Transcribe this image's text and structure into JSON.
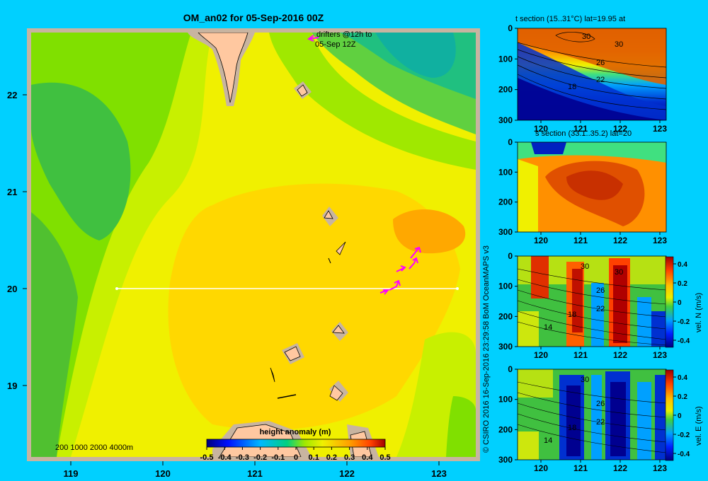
{
  "main_map": {
    "title": "OM_an02 for 05-Sep-2016 00Z",
    "drifters_label_1": "drifters @12h to",
    "drifters_label_2": "05-Sep 12Z",
    "depth_legend": "200  1000  2000  4000m",
    "colorbar_title": "height anomaly (m)",
    "colorbar_ticks": [
      "-0.5",
      "-0.4",
      "-0.3",
      "-0.2",
      "-0.1",
      "0",
      "0.1",
      "0.2",
      "0.3",
      "0.4",
      "0.5"
    ],
    "x_ticks": [
      "119",
      "120",
      "121",
      "122",
      "123"
    ],
    "y_ticks": [
      "22",
      "21",
      "20",
      "19"
    ],
    "section_line_lat": 20,
    "section_line_lon": [
      119.5,
      123.2
    ],
    "colors": {
      "land": "#ffc8a0",
      "shelf": "#c8b4a0",
      "border": "#c8b4a0",
      "drifter": "#ff00ff"
    }
  },
  "credit": "© CSIRO 2016   16-Sep-2016 23:29:58 BoM OceanMAPS v3",
  "chart_data": [
    {
      "type": "heatmap",
      "title": "OM_an02 for 05-Sep-2016 00Z",
      "x": [
        119,
        120,
        121,
        122,
        123
      ],
      "y": [
        19,
        20,
        21,
        22
      ],
      "legend_title": "height anomaly (m)",
      "clim": [
        -0.5,
        0.5
      ],
      "values_description_free": null
    },
    {
      "type": "heatmap",
      "title": "t section (15..31°C) lat=19.95 at",
      "x_ticks": [
        "120",
        "121",
        "122",
        "123"
      ],
      "y_ticks": [
        "0",
        "100",
        "200",
        "300"
      ],
      "contour_labels": [
        "30",
        "30",
        "26",
        "22",
        "18"
      ],
      "clim": [
        15,
        31
      ]
    },
    {
      "type": "heatmap",
      "title": "s section (33.1..35.2) lat=20",
      "x_ticks": [
        "120",
        "121",
        "122",
        "123"
      ],
      "y_ticks": [
        "0",
        "100",
        "200",
        "300"
      ],
      "clim": [
        33.1,
        35.2
      ]
    },
    {
      "type": "heatmap",
      "title": "",
      "colorbar_label": "vel. N (m/s)",
      "x_ticks": [
        "120",
        "121",
        "122",
        "123"
      ],
      "y_ticks": [
        "0",
        "100",
        "200",
        "300"
      ],
      "colorbar_ticks": [
        "0.4",
        "0.2",
        "0",
        "-0.2",
        "-0.4"
      ],
      "contour_labels": [
        "30",
        "30",
        "26",
        "22",
        "18",
        "14"
      ],
      "clim": [
        -0.4,
        0.4
      ]
    },
    {
      "type": "heatmap",
      "title": "",
      "colorbar_label": "vel. E (m/s)",
      "x_ticks": [
        "120",
        "121",
        "122",
        "123"
      ],
      "y_ticks": [
        "0",
        "100",
        "200",
        "300"
      ],
      "colorbar_ticks": [
        "0.4",
        "0.2",
        "0",
        "-0.2",
        "-0.4"
      ],
      "contour_labels": [
        "30",
        "26",
        "22",
        "18",
        "14"
      ],
      "clim": [
        -0.4,
        0.4
      ]
    }
  ]
}
